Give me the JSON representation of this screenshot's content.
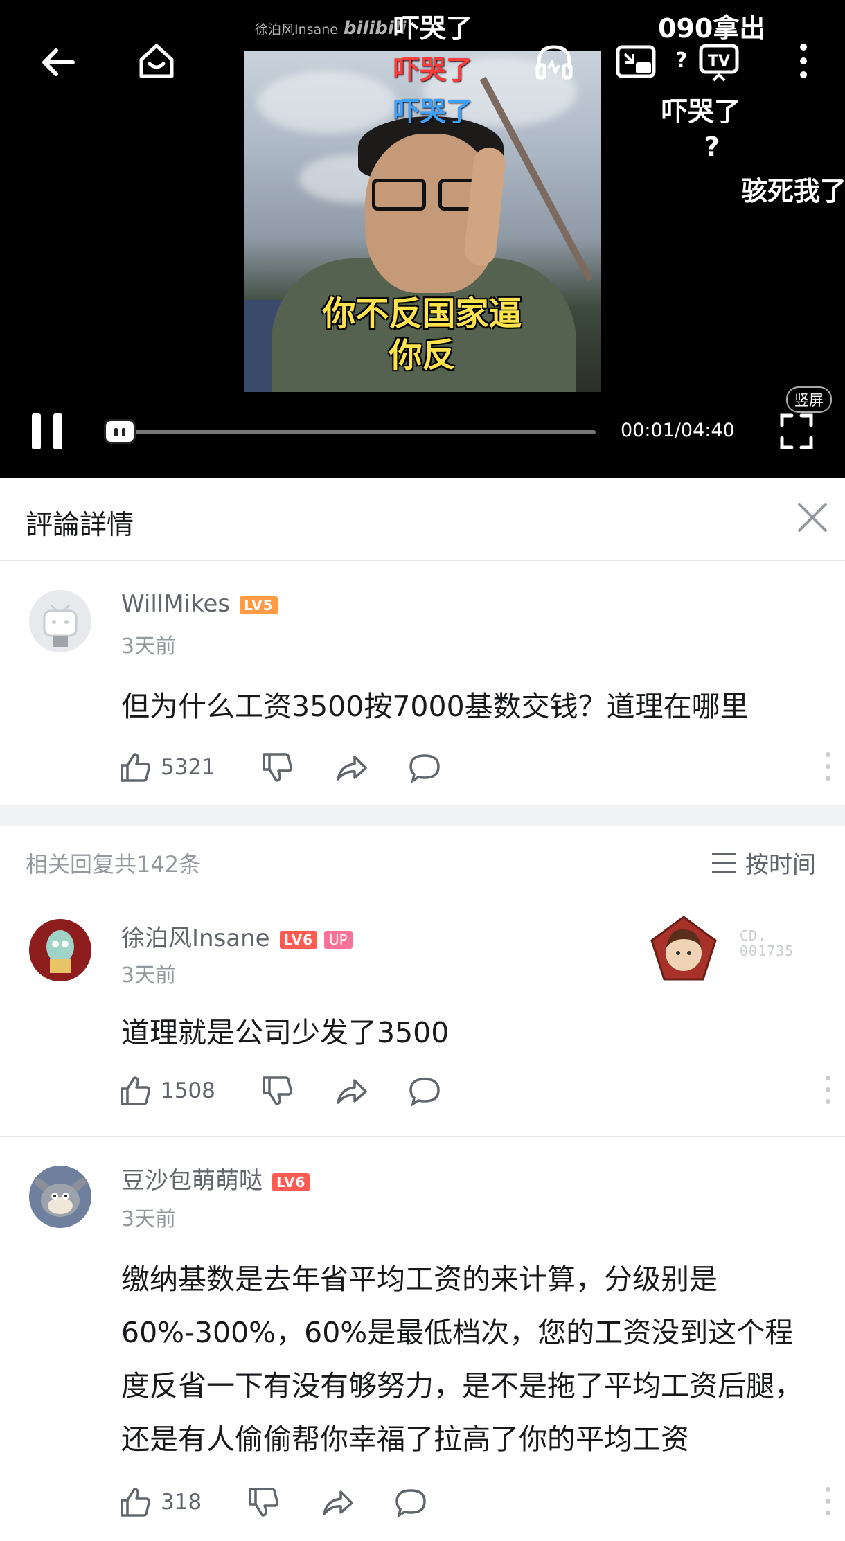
{
  "player": {
    "watermark_author": "徐泊风Insane",
    "watermark_brand": "bilibili",
    "captions": [
      "你不反国家逼",
      "你反"
    ],
    "danmaku": [
      {
        "text": "吓哭了",
        "color": "white"
      },
      {
        "text": "090拿出",
        "color": "white"
      },
      {
        "text": "吓哭了",
        "color": "red"
      },
      {
        "text": "吓哭了",
        "color": "blue"
      },
      {
        "text": "吓哭了",
        "color": "white"
      },
      {
        "text": "?",
        "color": "white"
      },
      {
        "text": "?",
        "color": "white"
      },
      {
        "text": "骇死我了",
        "color": "white"
      }
    ],
    "time": "00:01/04:40",
    "progress": 0.004,
    "vertical_label": "竖屏",
    "icons": [
      "back-arrow-icon",
      "home-icon",
      "headphones-icon",
      "pip-icon",
      "tv-cast-icon",
      "more-vertical-icon",
      "pause-icon",
      "fullscreen-icon"
    ]
  },
  "sheet": {
    "title": "評論詳情"
  },
  "main_comment": {
    "username": "WillMikes",
    "level": "LV5",
    "time_ago": "3天前",
    "text": "但为什么工资3500按7000基数交钱？道理在哪里",
    "likes": "5321"
  },
  "replies_header": {
    "count_text": "相关回复共142条",
    "sort_label": "按时间"
  },
  "replies": [
    {
      "username": "徐泊风Insane",
      "level": "LV6",
      "badge": "UP",
      "fan_number": "CD.\n001735",
      "time_ago": "3天前",
      "text": "道理就是公司少发了3500",
      "likes": "1508"
    },
    {
      "username": "豆沙包萌萌哒",
      "level": "LV6",
      "time_ago": "3天前",
      "text": "缴纳基数是去年省平均工资的来计算，分级别是60%-300%，60%是最低档次，您的工资没到这个程度反省一下有没有够努力，是不是拖了平均工资后腿，还是有人偷偷帮你幸福了拉高了你的平均工资",
      "likes": "318"
    }
  ],
  "colors": {
    "level5": "#ff9b44",
    "level6": "#ff5b52",
    "up_badge": "#fb7299",
    "muted_text": "#9499a0",
    "caption_yellow": "#ffe34d"
  }
}
